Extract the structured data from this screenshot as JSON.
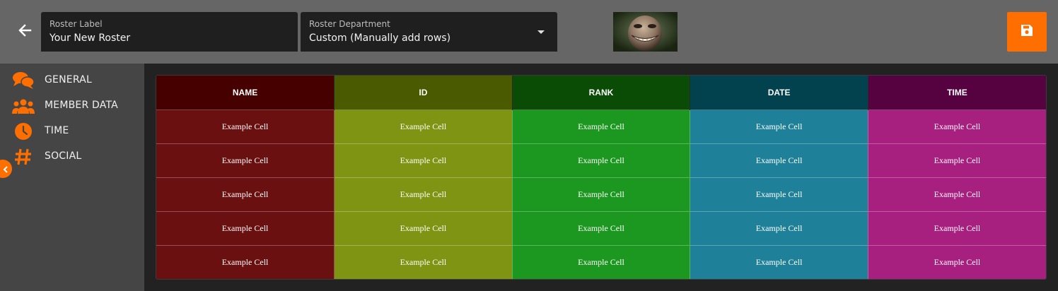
{
  "header": {
    "roster_label": {
      "label": "Roster Label",
      "value": "Your New Roster"
    },
    "roster_department": {
      "label": "Roster Department",
      "value": "Custom (Manually add rows)"
    },
    "icons": {
      "back": "arrow-left-icon",
      "save": "floppy-disk-icon",
      "dropdown": "caret-down-icon"
    },
    "accent_color": "#ff6f00"
  },
  "sidebar": {
    "items": [
      {
        "label": "GENERAL",
        "icon": "chat-bubbles-icon"
      },
      {
        "label": "MEMBER DATA",
        "icon": "users-icon"
      },
      {
        "label": "TIME",
        "icon": "clock-icon"
      },
      {
        "label": "SOCIAL",
        "icon": "hash-icon"
      }
    ],
    "collapse_icon": "chevron-left-icon"
  },
  "table": {
    "columns": [
      {
        "header": "NAME",
        "header_color": "#470000",
        "cell_color": "#6b1010"
      },
      {
        "header": "ID",
        "header_color": "#4a5a00",
        "cell_color": "#809413"
      },
      {
        "header": "RANK",
        "header_color": "#0a4c05",
        "cell_color": "#1c9820"
      },
      {
        "header": "DATE",
        "header_color": "#02414e",
        "cell_color": "#1f8199"
      },
      {
        "header": "TIME",
        "header_color": "#560140",
        "cell_color": "#a8207f"
      }
    ],
    "rows": [
      [
        "Example Cell",
        "Example Cell",
        "Example Cell",
        "Example Cell",
        "Example Cell"
      ],
      [
        "Example Cell",
        "Example Cell",
        "Example Cell",
        "Example Cell",
        "Example Cell"
      ],
      [
        "Example Cell",
        "Example Cell",
        "Example Cell",
        "Example Cell",
        "Example Cell"
      ],
      [
        "Example Cell",
        "Example Cell",
        "Example Cell",
        "Example Cell",
        "Example Cell"
      ],
      [
        "Example Cell",
        "Example Cell",
        "Example Cell",
        "Example Cell",
        "Example Cell"
      ]
    ]
  }
}
